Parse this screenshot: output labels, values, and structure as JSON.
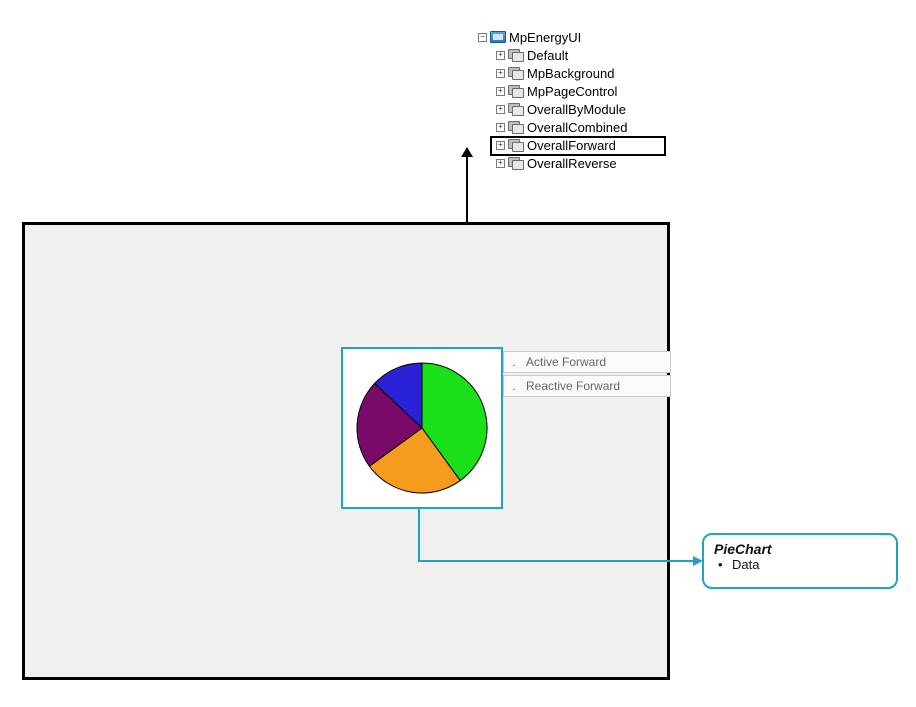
{
  "tree": {
    "root_label": "MpEnergyUI",
    "items": [
      {
        "label": "Default"
      },
      {
        "label": "MpBackground"
      },
      {
        "label": "MpPageControl"
      },
      {
        "label": "OverallByModule"
      },
      {
        "label": "OverallCombined"
      },
      {
        "label": "OverallForward",
        "selected": true
      },
      {
        "label": "OverallReverse"
      }
    ]
  },
  "legend": {
    "items": [
      {
        "label": "Active Forward"
      },
      {
        "label": "Reactive Forward"
      }
    ]
  },
  "callout": {
    "title": "PieChart",
    "item": "Data"
  },
  "chart_data": {
    "type": "pie",
    "title": "",
    "slices": [
      {
        "name": "Green",
        "value": 40,
        "color": "#19e019"
      },
      {
        "name": "Orange",
        "value": 25,
        "color": "#f59b1e"
      },
      {
        "name": "Purple",
        "value": 22,
        "color": "#7a0a6a"
      },
      {
        "name": "Blue",
        "value": 13,
        "color": "#2a22d6"
      }
    ]
  }
}
